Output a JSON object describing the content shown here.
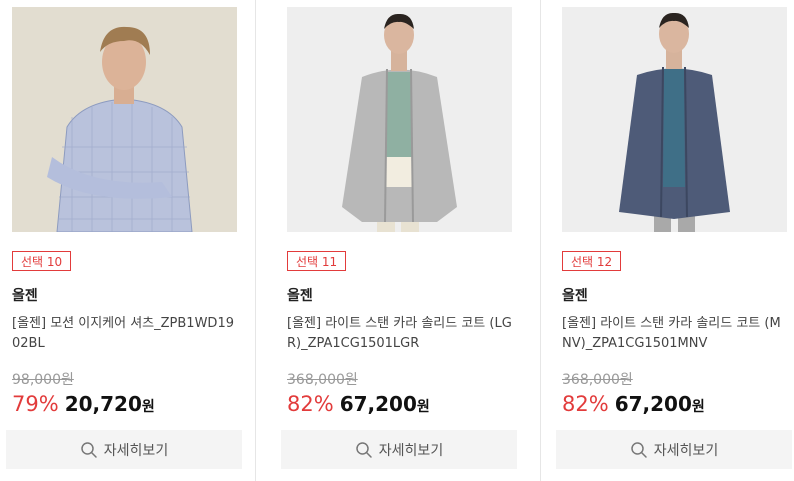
{
  "products": [
    {
      "badge": "선택 10",
      "brand": "올젠",
      "name": "[올젠] 모션 이지케어 셔츠_ZPB1WD1902BL",
      "original_price": "98,000원",
      "discount": "79%",
      "price": "20,720",
      "currency": "원",
      "detail_label": "자세히보기",
      "image": "model in blue plaid shirt"
    },
    {
      "badge": "선택 11",
      "brand": "올젠",
      "name": "[올젠] 라이트 스탠 카라 솔리드 코트 (LGR)_ZPA1CG1501LGR",
      "original_price": "368,000원",
      "discount": "82%",
      "price": "67,200",
      "currency": "원",
      "detail_label": "자세히보기",
      "image": "model in light gray coat"
    },
    {
      "badge": "선택 12",
      "brand": "올젠",
      "name": "[올젠] 라이트 스탠 카라 솔리드 코트 (MNV)_ZPA1CG1501MNV",
      "original_price": "368,000원",
      "discount": "82%",
      "price": "67,200",
      "currency": "원",
      "detail_label": "자세히보기",
      "image": "model in navy coat"
    }
  ],
  "colors": {
    "accent": "#e23b3b",
    "button_bg": "#f4f4f4",
    "divider": "#e6e6e6"
  },
  "icons": {
    "detail_button": "search-icon"
  }
}
